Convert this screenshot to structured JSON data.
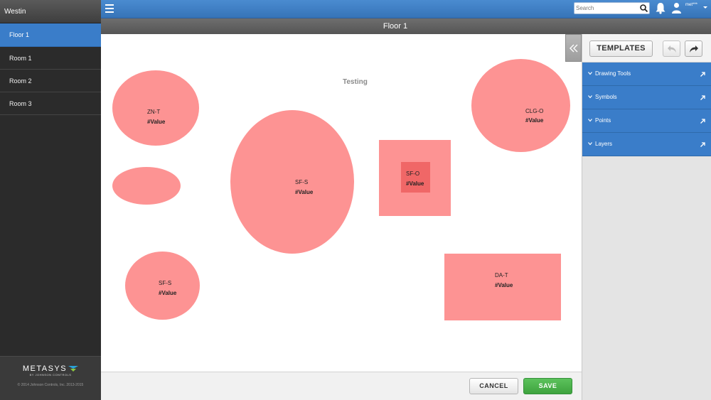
{
  "app": {
    "site_name": "Westin"
  },
  "sidebar": {
    "items": [
      {
        "label": "Floor 1",
        "active": true
      },
      {
        "label": "Room 1",
        "active": false
      },
      {
        "label": "Room 2",
        "active": false
      },
      {
        "label": "Room 3",
        "active": false
      }
    ],
    "logo_text": "METASYS",
    "logo_sub": "BY JOHNSON CONTROLS",
    "copyright": "© 2014 Johnson Controls, Inc. 2013-2015"
  },
  "header": {
    "search_placeholder": "Search",
    "username": "met***",
    "icons": [
      "menu-icon",
      "search-icon",
      "bell-icon",
      "user-icon"
    ]
  },
  "page": {
    "title": "Floor 1"
  },
  "canvas": {
    "title": "Testing",
    "shapes": [
      {
        "label": "ZN-T",
        "value": "#Value"
      },
      {
        "label": "",
        "value": ""
      },
      {
        "label": "SF-S",
        "value": "#Value"
      },
      {
        "label": "SF-O",
        "value": "#Value"
      },
      {
        "label": "CLG-O",
        "value": "#Value"
      },
      {
        "label": "SF-S",
        "value": "#Value"
      },
      {
        "label": "DA-T",
        "value": "#Value"
      }
    ]
  },
  "footer": {
    "cancel_label": "CANCEL",
    "save_label": "SAVE"
  },
  "right_panel": {
    "templates_label": "TEMPLATES",
    "sections": [
      {
        "label": "Drawing Tools"
      },
      {
        "label": "Symbols"
      },
      {
        "label": "Points"
      },
      {
        "label": "Layers"
      }
    ]
  },
  "colors": {
    "accent_blue": "#3a7dc9",
    "shape_fill": "#fd9393",
    "shape_inner": "#f06767",
    "save_green": "#45ab45"
  }
}
